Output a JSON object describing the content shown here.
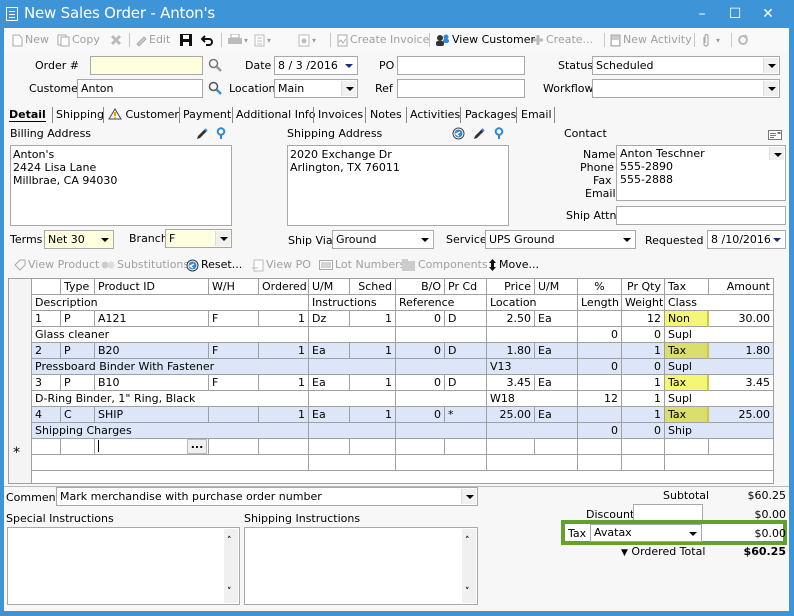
{
  "window": {
    "title": "New Sales Order - Anton's",
    "controls": {
      "minimize": "–",
      "maximize": "☐",
      "close": "✕"
    }
  },
  "toolbar": {
    "new": "New",
    "copy": "Copy",
    "edit": "Edit",
    "create_invoice": "Create Invoice",
    "view_customer": "View Customer",
    "create": "Create...",
    "new_activity": "New Activity"
  },
  "header": {
    "order_label": "Order #",
    "order_value": "",
    "customer_label": "Customer",
    "customer_value": "Anton",
    "date_label": "Date",
    "date_value": "8 / 3 /2016",
    "location_label": "Location",
    "location_value": "Main",
    "po_label": "PO",
    "po_value": "",
    "ref_label": "Ref",
    "ref_value": "",
    "status_label": "Status",
    "status_value": "Scheduled",
    "workflow_label": "Workflow",
    "workflow_value": ""
  },
  "tabs": [
    "Detail",
    "Shipping",
    "Customer",
    "Payment",
    "Additional Info",
    "Invoices",
    "Notes",
    "Activities",
    "Packages",
    "Email"
  ],
  "billing": {
    "label": "Billing Address",
    "lines": "Anton's\n2424 Lisa Lane\nMillbrae, CA 94030"
  },
  "shipping": {
    "label": "Shipping Address",
    "lines": "2020 Exchange Dr\nArlington, TX 76011"
  },
  "contact": {
    "label": "Contact",
    "name_label": "Name",
    "name_value": "Anton Teschner",
    "phone_label": "Phone",
    "phone_value": "555-2890",
    "fax_label": "Fax",
    "fax_value": "555-2888",
    "email_label": "Email",
    "email_value": "",
    "ship_attn_label": "Ship Attn",
    "ship_attn_value": ""
  },
  "terms": {
    "label": "Terms",
    "value": "Net 30"
  },
  "branch": {
    "label": "Branch",
    "value": "F"
  },
  "ship_via": {
    "label": "Ship Via",
    "value": "Ground"
  },
  "service": {
    "label": "Service",
    "value": "UPS Ground"
  },
  "requested": {
    "label": "Requested",
    "value": "8 /10/2016"
  },
  "line_toolbar": {
    "view_product": "View Product",
    "substitutions": "Substitutions",
    "reset": "Reset...",
    "view_po": "View PO",
    "lot_numbers": "Lot Numbers",
    "components": "Components",
    "move": "Move..."
  },
  "grid": {
    "header1": [
      "",
      "Type",
      "Product ID",
      "W/H",
      "Ordered",
      "U/M",
      "Sched",
      "B/O",
      "Pr Cd",
      "Price",
      "U/M",
      "%",
      "Pr Qty",
      "Tax",
      "Amount"
    ],
    "header2": {
      "description": "Description",
      "instructions": "Instructions",
      "reference": "Reference",
      "location": "Location",
      "length": "Length",
      "weight": "Weight",
      "class": "Class"
    },
    "rows": [
      {
        "num": "1",
        "type": "P",
        "product": "A121",
        "wh": "F",
        "ordered": "1",
        "um": "Dz",
        "sched": "1",
        "bo": "0",
        "prcd": "D",
        "price": "2.50",
        "um2": "Ea",
        "pct": "",
        "prqty": "12",
        "tax": "Non",
        "amount": "30.00",
        "description": "Glass cleaner",
        "instructions": "",
        "reference": "",
        "location": "",
        "length": "0",
        "weight": "0",
        "class": "Supl"
      },
      {
        "num": "2",
        "type": "P",
        "product": "B20",
        "wh": "F",
        "ordered": "1",
        "um": "Ea",
        "sched": "1",
        "bo": "0",
        "prcd": "D",
        "price": "1.80",
        "um2": "Ea",
        "pct": "",
        "prqty": "1",
        "tax": "Tax",
        "amount": "1.80",
        "description": "Pressboard Binder With Fastener",
        "instructions": "",
        "reference": "",
        "location": "V13",
        "length": "0",
        "weight": "0",
        "class": "Supl"
      },
      {
        "num": "3",
        "type": "P",
        "product": "B10",
        "wh": "F",
        "ordered": "1",
        "um": "Ea",
        "sched": "1",
        "bo": "0",
        "prcd": "D",
        "price": "3.45",
        "um2": "Ea",
        "pct": "",
        "prqty": "1",
        "tax": "Tax",
        "amount": "3.45",
        "description": "D-Ring Binder, 1\" Ring, Black",
        "instructions": "",
        "reference": "",
        "location": "W18",
        "length": "12",
        "weight": "1",
        "class": "Supl"
      },
      {
        "num": "4",
        "type": "C",
        "product": "SHIP",
        "wh": "",
        "ordered": "1",
        "um": "Ea",
        "sched": "1",
        "bo": "0",
        "prcd": "*",
        "price": "25.00",
        "um2": "Ea",
        "pct": "",
        "prqty": "1",
        "tax": "Tax",
        "amount": "25.00",
        "description": "Shipping Charges",
        "instructions": "",
        "reference": "",
        "location": "",
        "length": "0",
        "weight": "0",
        "class": "Ship"
      }
    ],
    "new_row_marker": "*",
    "ellipsis": "..."
  },
  "comment": {
    "label": "Comment",
    "value": "Mark merchandise with purchase order number"
  },
  "special_instructions": {
    "label": "Special Instructions",
    "value": ""
  },
  "shipping_instructions": {
    "label": "Shipping Instructions",
    "value": ""
  },
  "totals": {
    "subtotal_label": "Subtotal",
    "subtotal_value": "$60.25",
    "discount_label": "Discount",
    "discount_input": "",
    "discount_value": "$0.00",
    "tax_label": "Tax",
    "tax_provider": "Avatax",
    "tax_value": "$0.00",
    "ordered_total_label": "Ordered Total",
    "ordered_total_value": "$60.25"
  },
  "colors": {
    "titlebar": "#3d94d6",
    "row_highlight": "#dde6f8",
    "tax_highlight": "#f6f675",
    "callout_border": "#62a12b",
    "yellow_field": "#ffffe0"
  }
}
